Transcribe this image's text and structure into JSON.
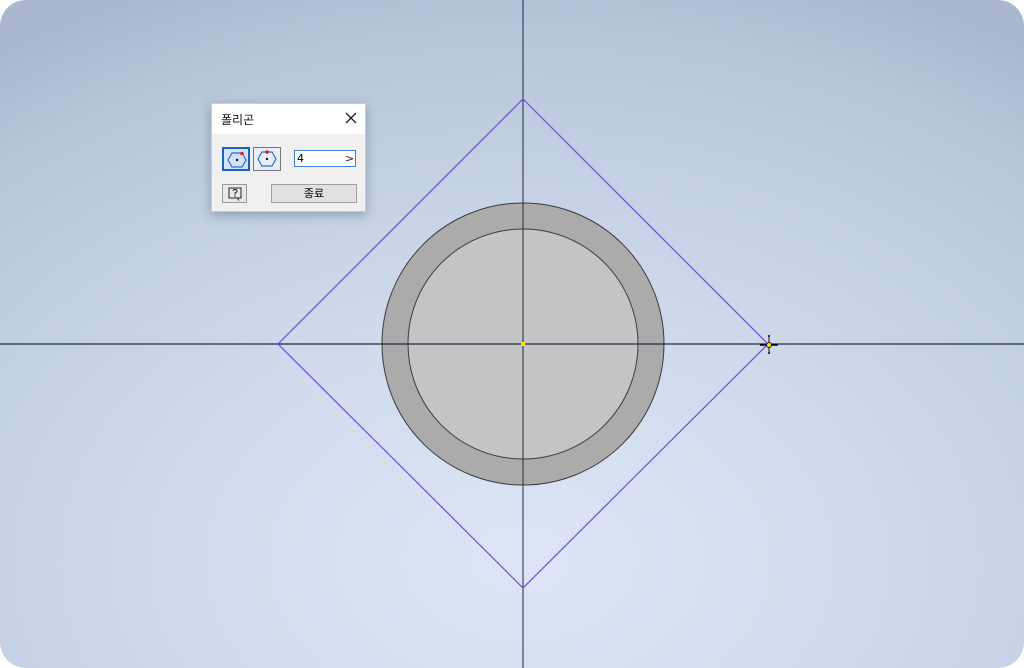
{
  "dialog": {
    "title": "폴리곤",
    "close_icon": "close-icon",
    "modes": [
      {
        "name": "inscribed-mode",
        "icon": "polygon-inscribed-icon",
        "active": true
      },
      {
        "name": "circumscribed-mode",
        "icon": "polygon-circumscribed-icon",
        "active": false
      }
    ],
    "sides_value": "4",
    "sides_arrow": ">",
    "help_icon": "help-icon",
    "done_label": "종료"
  },
  "colors": {
    "polygon_line": "#6b4be0",
    "axis_line": "#1f2a44",
    "circle_outer_fill": "#ababab",
    "circle_inner_fill": "#c4c4c4",
    "center_point": "#f2e400",
    "active_button_border": "#1f5fb8"
  }
}
